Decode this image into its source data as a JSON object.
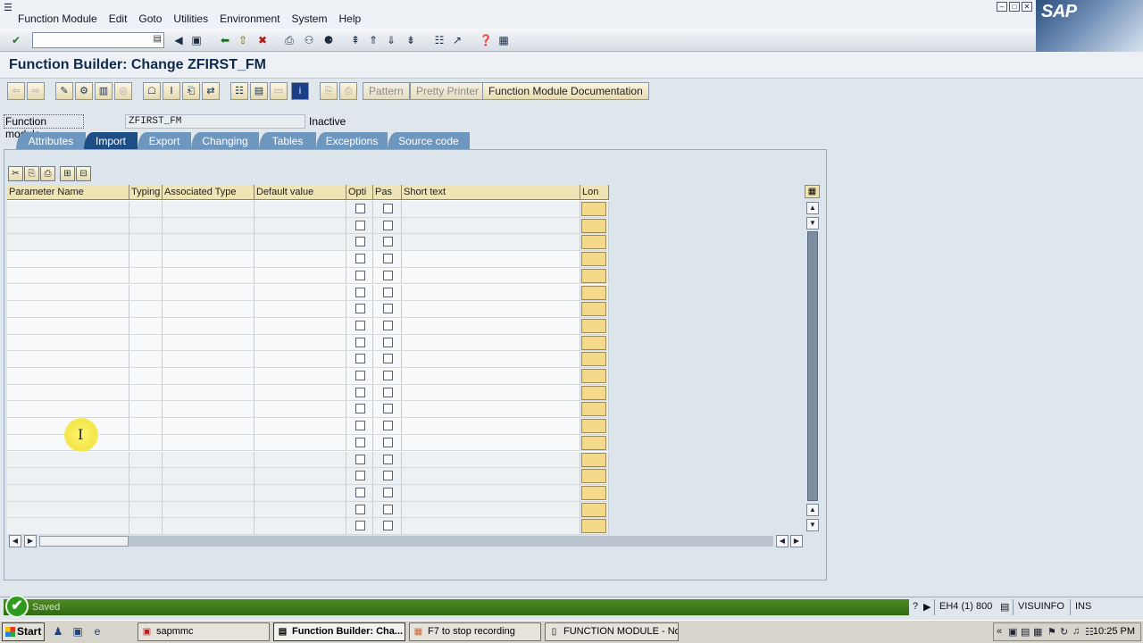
{
  "menu": {
    "items": [
      "Function Module",
      "Edit",
      "Goto",
      "Utilities",
      "Environment",
      "System",
      "Help"
    ]
  },
  "window": {
    "buttons": [
      "minimize",
      "restore",
      "close"
    ],
    "logo_text": "SAP"
  },
  "std_toolbar": {
    "command_field_value": "",
    "icons": [
      "enter-icon",
      "command-dropdown-icon",
      "back-arrow-icon",
      "save-icon",
      "back-icon",
      "exit-icon",
      "cancel-icon",
      "print-icon",
      "find-icon",
      "find-next-icon",
      "first-page-icon",
      "previous-page-icon",
      "next-page-icon",
      "last-page-icon",
      "create-session-icon",
      "shortcut-icon",
      "help-icon",
      "layout-icon"
    ]
  },
  "title": "Function Builder: Change ZFIRST_FM",
  "app_toolbar": {
    "pattern_label": "Pattern",
    "pretty_printer_label": "Pretty Printer",
    "documentation_label": "Function Module Documentation"
  },
  "function_module": {
    "label": "Function module",
    "value": "ZFIRST_FM",
    "status": "Inactive"
  },
  "tabs": [
    {
      "label": "Attributes",
      "active": false
    },
    {
      "label": "Import",
      "active": true
    },
    {
      "label": "Export",
      "active": false
    },
    {
      "label": "Changing",
      "active": false
    },
    {
      "label": "Tables",
      "active": false
    },
    {
      "label": "Exceptions",
      "active": false
    },
    {
      "label": "Source code",
      "active": false
    }
  ],
  "table": {
    "columns": [
      "Parameter Name",
      "Typing",
      "Associated Type",
      "Default value",
      "Opti",
      "Pas",
      "Short text",
      "Lon"
    ],
    "row_count": 20,
    "rows": []
  },
  "status": {
    "message": "Saved",
    "system": "EH4 (1) 800",
    "server": "VISUINFO",
    "mode": "INS"
  },
  "taskbar": {
    "start_label": "Start",
    "tasks": [
      {
        "label": "sapmmc",
        "active": false
      },
      {
        "label": "Function Builder: Cha...",
        "active": true
      },
      {
        "label": "F7 to stop recording",
        "active": false
      },
      {
        "label": "FUNCTION MODULE - No...",
        "active": false
      }
    ],
    "clock": "10:25 PM"
  },
  "colors": {
    "accent_tab_active": "#1d4f86",
    "accent_tab": "#6e97bf",
    "status_ok": "#2f6c10",
    "header_bg": "#efe4b5"
  }
}
